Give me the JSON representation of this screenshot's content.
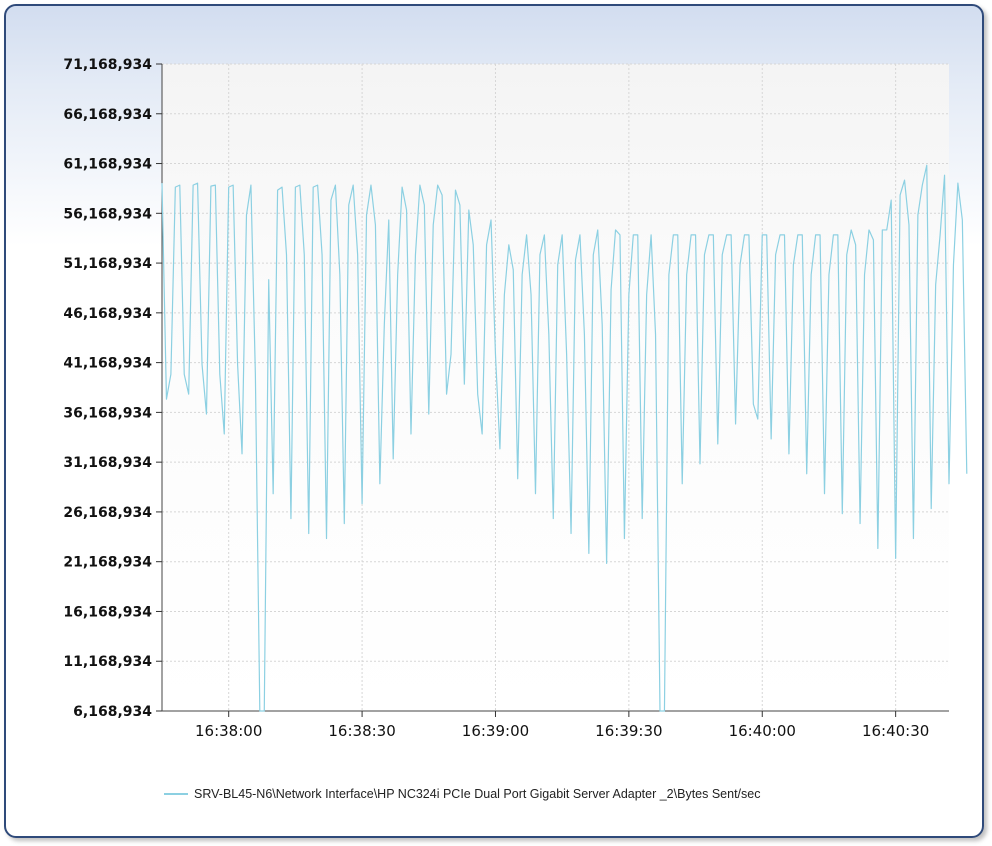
{
  "chart_data": {
    "type": "line",
    "title": "",
    "xlabel": "",
    "ylabel": "",
    "ylim": [
      6168934,
      71168934
    ],
    "y_ticks": [
      "6,168,934",
      "11,168,934",
      "16,168,934",
      "21,168,934",
      "26,168,934",
      "31,168,934",
      "36,168,934",
      "41,168,934",
      "46,168,934",
      "51,168,934",
      "56,168,934",
      "61,168,934",
      "66,168,934",
      "71,168,934"
    ],
    "x_ticks": [
      "16:38:00",
      "16:38:30",
      "16:39:00",
      "16:39:30",
      "16:40:00",
      "16:40:30"
    ],
    "xlim": [
      "16:37:45",
      "16:40:42"
    ],
    "grid": true,
    "legend_position": "bottom",
    "color": "#8cd0e2",
    "series": [
      {
        "name": "SRV-BL45-N6\\Network Interface\\HP NC324i PCIe Dual Port Gigabit Server Adapter _2\\Bytes Sent/sec",
        "x_start": "16:37:45",
        "x_step_seconds": 1,
        "values": [
          59200000,
          37500000,
          40000000,
          58800000,
          59000000,
          40000000,
          38000000,
          59000000,
          59200000,
          41000000,
          36000000,
          58900000,
          59000000,
          40000000,
          34000000,
          58800000,
          59000000,
          41000000,
          32000000,
          56000000,
          59000000,
          40000000,
          6168934,
          6168934,
          49500000,
          28000000,
          58500000,
          58800000,
          52000000,
          25500000,
          58800000,
          59000000,
          52000000,
          24000000,
          58800000,
          59000000,
          52000000,
          23500000,
          57500000,
          59000000,
          50000000,
          25000000,
          57000000,
          59000000,
          52000000,
          27000000,
          56000000,
          59000000,
          55000000,
          29000000,
          45000000,
          55500000,
          31500000,
          50000000,
          58800000,
          56500000,
          34000000,
          52000000,
          59000000,
          57000000,
          36000000,
          55000000,
          59000000,
          58000000,
          38000000,
          42000000,
          58500000,
          57000000,
          39000000,
          56500000,
          53000000,
          38000000,
          34000000,
          53000000,
          55500000,
          42000000,
          32500000,
          48000000,
          53000000,
          50500000,
          29500000,
          50000000,
          54000000,
          48000000,
          28000000,
          52000000,
          54000000,
          44000000,
          25500000,
          51000000,
          54000000,
          42000000,
          24000000,
          51500000,
          54000000,
          44000000,
          22000000,
          52000000,
          54500000,
          45000000,
          21000000,
          48500000,
          54500000,
          54000000,
          23500000,
          48000000,
          54000000,
          54000000,
          25500000,
          48000000,
          54000000,
          44000000,
          6168934,
          6168934,
          50000000,
          54000000,
          54000000,
          29000000,
          50000000,
          54000000,
          54000000,
          31000000,
          52000000,
          54000000,
          54000000,
          33000000,
          52000000,
          54000000,
          54000000,
          35000000,
          51000000,
          54000000,
          54000000,
          37000000,
          35500000,
          54000000,
          54000000,
          33500000,
          52000000,
          54000000,
          54000000,
          32000000,
          51000000,
          54000000,
          54000000,
          30000000,
          50000000,
          54000000,
          54000000,
          28000000,
          50000000,
          54000000,
          54000000,
          26000000,
          52000000,
          54500000,
          53000000,
          25000000,
          50000000,
          54500000,
          53500000,
          22500000,
          54500000,
          54500000,
          57500000,
          21500000,
          58000000,
          59500000,
          55000000,
          23500000,
          56000000,
          59000000,
          61000000,
          26500000,
          49000000,
          54000000,
          60000000,
          29000000,
          51000000,
          59200000,
          55500000,
          30000000
        ]
      }
    ]
  }
}
